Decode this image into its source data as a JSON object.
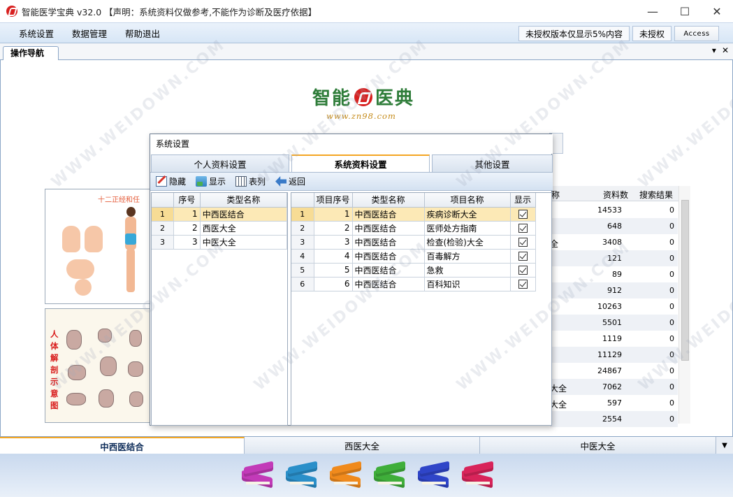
{
  "window": {
    "title": "智能医学宝典 v32.0 【声明：系统资料仅做参考,不能作为诊断及医疗依据】",
    "minimize": "—",
    "maximize": "☐",
    "close": "✕"
  },
  "menu": {
    "items": [
      "系统设置",
      "数据管理",
      "帮助退出"
    ],
    "license_notice": "未授权版本仅显示5%内容",
    "license_status": "未授权",
    "db_type": "Access"
  },
  "doc_tab": {
    "label": "操作导航",
    "dropdown": "▾",
    "close": "✕"
  },
  "logo": {
    "title_left": "智能",
    "title_right": "医典",
    "url": "www.zn98.com"
  },
  "image_panels": {
    "panel1_caption": "十二正经和任",
    "panel2_text": "人体解剖示意图"
  },
  "background_table": {
    "headers": [
      "称",
      "资料数",
      "搜索结果"
    ],
    "rows": [
      {
        "name": "",
        "count": "14533",
        "result": "0"
      },
      {
        "name": "",
        "count": "648",
        "result": "0"
      },
      {
        "name": "全",
        "count": "3408",
        "result": "0"
      },
      {
        "name": "",
        "count": "121",
        "result": "0"
      },
      {
        "name": "",
        "count": "89",
        "result": "0"
      },
      {
        "name": "",
        "count": "912",
        "result": "0"
      },
      {
        "name": "",
        "count": "10263",
        "result": "0"
      },
      {
        "name": "",
        "count": "5501",
        "result": "0"
      },
      {
        "name": "",
        "count": "1119",
        "result": "0"
      },
      {
        "name": "",
        "count": "11129",
        "result": "0"
      },
      {
        "name": "",
        "count": "24867",
        "result": "0"
      },
      {
        "name": "大全",
        "count": "7062",
        "result": "0"
      },
      {
        "name": "大全",
        "count": "597",
        "result": "0"
      },
      {
        "name": "",
        "count": "2554",
        "result": "0"
      }
    ]
  },
  "dialog": {
    "title": "系统设置",
    "tabs": [
      "个人资料设置",
      "系统资料设置",
      "其他设置"
    ],
    "active_tab": 1,
    "toolbar": [
      "隐藏",
      "显示",
      "表列",
      "返回"
    ],
    "left_grid": {
      "headers": [
        "序号",
        "类型名称"
      ],
      "rows": [
        {
          "rn": "1",
          "seq": "1",
          "type": "中西医结合"
        },
        {
          "rn": "2",
          "seq": "2",
          "type": "西医大全"
        },
        {
          "rn": "3",
          "seq": "3",
          "type": "中医大全"
        }
      ],
      "selected": 0
    },
    "right_grid": {
      "headers": [
        "项目序号",
        "类型名称",
        "项目名称",
        "显示"
      ],
      "rows": [
        {
          "rn": "1",
          "seq": "1",
          "type": "中西医结合",
          "item": "疾病诊断大全",
          "show": true
        },
        {
          "rn": "2",
          "seq": "2",
          "type": "中西医结合",
          "item": "医师处方指南",
          "show": true
        },
        {
          "rn": "3",
          "seq": "3",
          "type": "中西医结合",
          "item": "检查(检验)大全",
          "show": true
        },
        {
          "rn": "4",
          "seq": "4",
          "type": "中西医结合",
          "item": "百毒解方",
          "show": true
        },
        {
          "rn": "5",
          "seq": "5",
          "type": "中西医结合",
          "item": "急救",
          "show": true
        },
        {
          "rn": "6",
          "seq": "6",
          "type": "中西医结合",
          "item": "百科知识",
          "show": true
        }
      ],
      "selected": 0
    }
  },
  "bottom_tabs": [
    "中西医结合",
    "西医大全",
    "中医大全"
  ],
  "bottom_active": 0,
  "dock_books": [
    {
      "name": "book-purple",
      "color": "#c23ab8"
    },
    {
      "name": "book-teal",
      "color": "#2a8fc9"
    },
    {
      "name": "book-orange",
      "color": "#f08a1c"
    },
    {
      "name": "book-green",
      "color": "#3fae3a"
    },
    {
      "name": "book-blue",
      "color": "#2f45c8"
    },
    {
      "name": "book-red",
      "color": "#d8245a"
    }
  ],
  "watermark": "WWW.WEIDOWN.COM"
}
